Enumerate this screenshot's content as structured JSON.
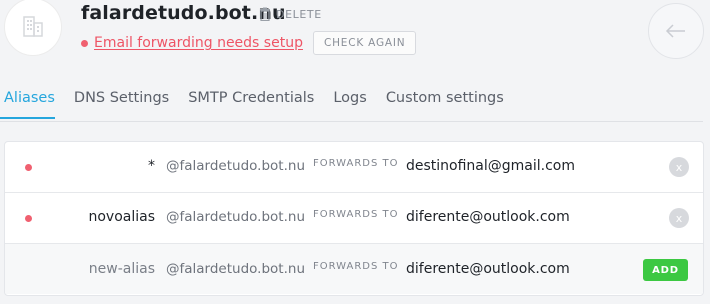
{
  "header": {
    "domain": "falardetudo.bot.nu",
    "delete_label": "DELETE",
    "status_text": "Email forwarding needs setup",
    "check_again_label": "CHECK AGAIN",
    "logo_icon": "building-icon",
    "back_icon": "arrow-left-icon"
  },
  "tabs": [
    {
      "label": "Aliases",
      "active": true
    },
    {
      "label": "DNS Settings",
      "active": false
    },
    {
      "label": "SMTP Credentials",
      "active": false
    },
    {
      "label": "Logs",
      "active": false
    },
    {
      "label": "Custom settings",
      "active": false
    }
  ],
  "aliases": {
    "forwards_label": "FORWARDS TO",
    "rows": [
      {
        "alias": "*",
        "domain": "@falardetudo.bot.nu",
        "destination": "destinofinal@gmail.com",
        "action": "x"
      },
      {
        "alias": "novoalias",
        "domain": "@falardetudo.bot.nu",
        "destination": "diferente@outlook.com",
        "action": "x"
      }
    ],
    "new_row": {
      "alias_placeholder": "new-alias",
      "domain": "@falardetudo.bot.nu",
      "destination_placeholder": "diferente@outlook.com",
      "add_label": "ADD"
    }
  },
  "colors": {
    "accent": "#25a6dd",
    "warning": "#ee5566",
    "add_green": "#3cc842"
  }
}
